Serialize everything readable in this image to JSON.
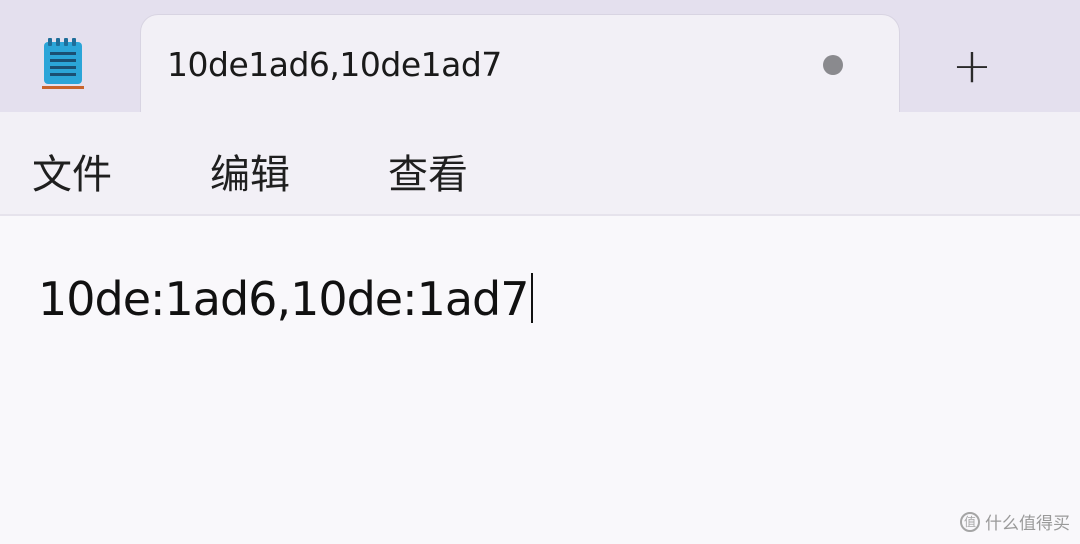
{
  "tab": {
    "title": "10de1ad6,10de1ad7",
    "unsaved_indicator": "dot",
    "new_tab_label": "+"
  },
  "app_icon": "notepad-icon",
  "menu": {
    "items": [
      {
        "label": "文件"
      },
      {
        "label": "编辑"
      },
      {
        "label": "查看"
      }
    ]
  },
  "editor": {
    "content": "10de:1ad6,10de:1ad7"
  },
  "watermark": {
    "text": "什么值得买",
    "logo_glyph": "值"
  },
  "colors": {
    "titlebar_bg": "#e4e0ee",
    "tab_bg": "#f2f0f6",
    "editor_bg": "#f9f8fb",
    "icon_accent": "#2ba5d8",
    "icon_underline": "#c8642c"
  }
}
